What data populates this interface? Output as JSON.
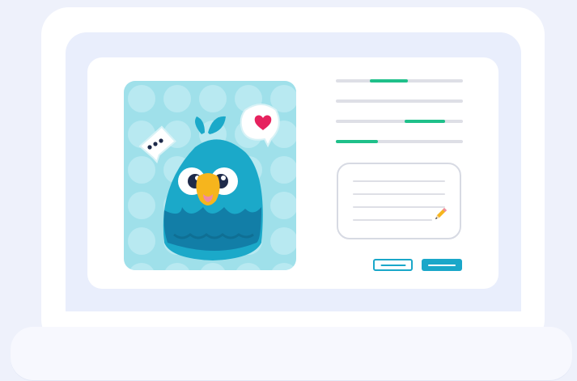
{
  "illustration": {
    "subject": "laptop-with-profile-form",
    "avatar": "parrot-mascot",
    "speech_bubbles": [
      "ellipsis-bubble-icon",
      "heart-bubble-icon"
    ]
  },
  "form": {
    "progress_levels": [
      {
        "start": 0.27,
        "fill": 0.3
      },
      {
        "start": 0.0,
        "fill": 0.0
      },
      {
        "start": 0.54,
        "fill": 0.32
      },
      {
        "start": 0.0,
        "fill": 0.33
      }
    ],
    "note_line_count": 4,
    "buttons": [
      "outline-button",
      "primary-button"
    ]
  },
  "colors": {
    "background": "#eef1fb",
    "accent_green": "#1fc08a",
    "accent_blue": "#1aa7c9",
    "parrot_body": "#1ba9c9",
    "panel_bg": "#9fe0ea",
    "beak": "#f6b51d",
    "heart": "#e6225e"
  }
}
